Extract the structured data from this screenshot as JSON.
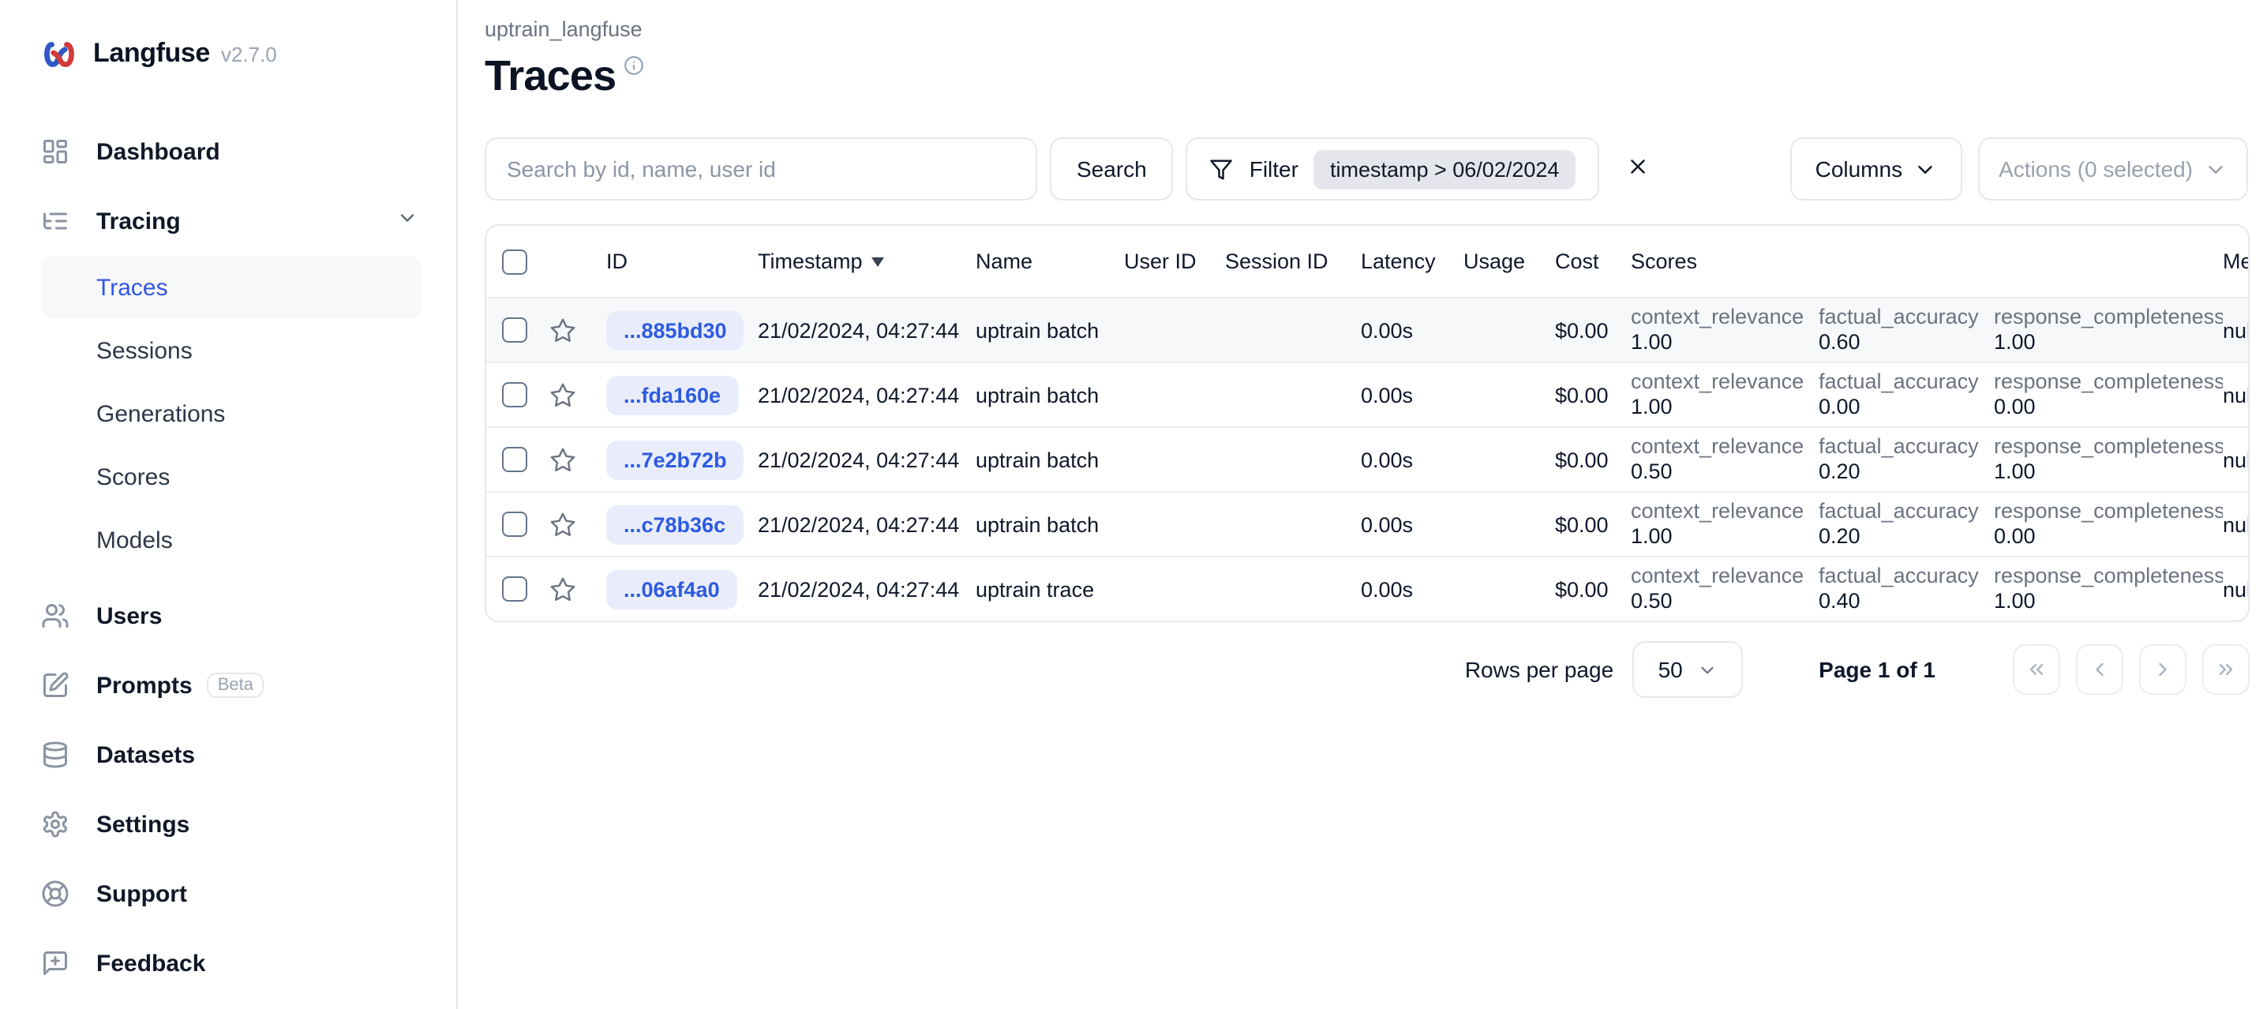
{
  "brand": {
    "name": "Langfuse",
    "version": "v2.7.0"
  },
  "colors": {
    "accent_blue": "#3056e4",
    "id_pill_bg": "#e9edfb",
    "filter_chip_bg": "#e4e6ec",
    "active_item_bg": "#f7f8fa",
    "border": "#e6e8eb",
    "muted_text": "#6b7280",
    "dark_text": "#0f172a",
    "logo_blue": "#2f57c7",
    "logo_red": "#d13b3b"
  },
  "sidebar": {
    "items": [
      {
        "label": "Dashboard"
      },
      {
        "label": "Tracing"
      },
      {
        "label": "Users"
      },
      {
        "label": "Prompts",
        "badge": "Beta"
      },
      {
        "label": "Datasets"
      },
      {
        "label": "Settings"
      },
      {
        "label": "Support"
      },
      {
        "label": "Feedback"
      }
    ],
    "tracing_sub": [
      {
        "label": "Traces",
        "active": true
      },
      {
        "label": "Sessions"
      },
      {
        "label": "Generations"
      },
      {
        "label": "Scores"
      },
      {
        "label": "Models"
      }
    ]
  },
  "header": {
    "breadcrumb": "uptrain_langfuse",
    "title": "Traces"
  },
  "toolbar": {
    "search_placeholder": "Search by id, name, user id",
    "search_button": "Search",
    "filter_button": "Filter",
    "filter_chip": "timestamp > 06/02/2024",
    "columns_button": "Columns",
    "actions_button": "Actions (0 selected)"
  },
  "table": {
    "columns": {
      "id": "ID",
      "timestamp": "Timestamp",
      "name": "Name",
      "user_id": "User ID",
      "session_id": "Session ID",
      "latency": "Latency",
      "usage": "Usage",
      "cost": "Cost",
      "scores": "Scores",
      "metadata": "Metadata"
    },
    "sort": {
      "column": "Timestamp",
      "direction": "desc"
    },
    "rows": [
      {
        "id": "...885bd30",
        "timestamp": "21/02/2024, 04:27:44",
        "name": "uptrain batch",
        "user_id": "",
        "session_id": "",
        "latency": "0.00s",
        "usage": "",
        "cost": "$0.00",
        "scores": [
          {
            "label": "context_relevance",
            "value": "1.00"
          },
          {
            "label": "factual_accuracy",
            "value": "0.60"
          },
          {
            "label": "response_completeness",
            "value": "1.00"
          }
        ],
        "metadata": "null"
      },
      {
        "id": "...fda160e",
        "timestamp": "21/02/2024, 04:27:44",
        "name": "uptrain batch",
        "user_id": "",
        "session_id": "",
        "latency": "0.00s",
        "usage": "",
        "cost": "$0.00",
        "scores": [
          {
            "label": "context_relevance",
            "value": "1.00"
          },
          {
            "label": "factual_accuracy",
            "value": "0.00"
          },
          {
            "label": "response_completeness",
            "value": "0.00"
          }
        ],
        "metadata": "null"
      },
      {
        "id": "...7e2b72b",
        "timestamp": "21/02/2024, 04:27:44",
        "name": "uptrain batch",
        "user_id": "",
        "session_id": "",
        "latency": "0.00s",
        "usage": "",
        "cost": "$0.00",
        "scores": [
          {
            "label": "context_relevance",
            "value": "0.50"
          },
          {
            "label": "factual_accuracy",
            "value": "0.20"
          },
          {
            "label": "response_completeness",
            "value": "1.00"
          }
        ],
        "metadata": "null"
      },
      {
        "id": "...c78b36c",
        "timestamp": "21/02/2024, 04:27:44",
        "name": "uptrain batch",
        "user_id": "",
        "session_id": "",
        "latency": "0.00s",
        "usage": "",
        "cost": "$0.00",
        "scores": [
          {
            "label": "context_relevance",
            "value": "1.00"
          },
          {
            "label": "factual_accuracy",
            "value": "0.20"
          },
          {
            "label": "response_completeness",
            "value": "0.00"
          }
        ],
        "metadata": "null"
      },
      {
        "id": "...06af4a0",
        "timestamp": "21/02/2024, 04:27:44",
        "name": "uptrain trace",
        "user_id": "",
        "session_id": "",
        "latency": "0.00s",
        "usage": "",
        "cost": "$0.00",
        "scores": [
          {
            "label": "context_relevance",
            "value": "0.50"
          },
          {
            "label": "factual_accuracy",
            "value": "0.40"
          },
          {
            "label": "response_completeness",
            "value": "1.00"
          }
        ],
        "metadata": "null"
      }
    ]
  },
  "pagination": {
    "rows_per_page_label": "Rows per page",
    "rows_per_page_value": "50",
    "page_info": "Page 1 of 1"
  }
}
